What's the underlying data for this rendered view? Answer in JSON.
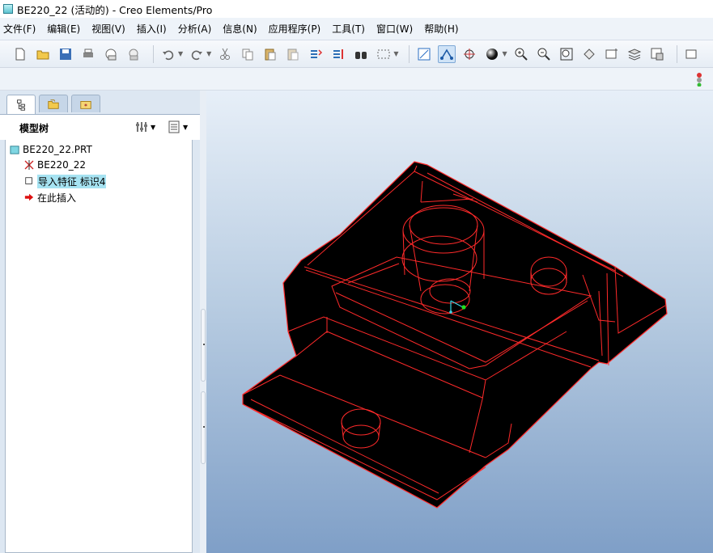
{
  "window": {
    "title": "BE220_22 (活动的) - Creo Elements/Pro"
  },
  "menu": [
    "文件(F)",
    "编辑(E)",
    "视图(V)",
    "插入(I)",
    "分析(A)",
    "信息(N)",
    "应用程序(P)",
    "工具(T)",
    "窗口(W)",
    "帮助(H)"
  ],
  "panel": {
    "title": "模型树"
  },
  "tree": {
    "root": "BE220_22.PRT",
    "items": [
      {
        "label": "BE220_22",
        "icon": "datum-csys-icon"
      },
      {
        "label": "导入特征 标识4",
        "icon": "import-feature-icon",
        "selected": true
      },
      {
        "label": "在此插入",
        "icon": "insert-here-arrow-icon"
      }
    ]
  },
  "colors": {
    "accent": "#a6e3f2",
    "model_edges": "#ff2a2a",
    "model_fill": "#000000"
  }
}
